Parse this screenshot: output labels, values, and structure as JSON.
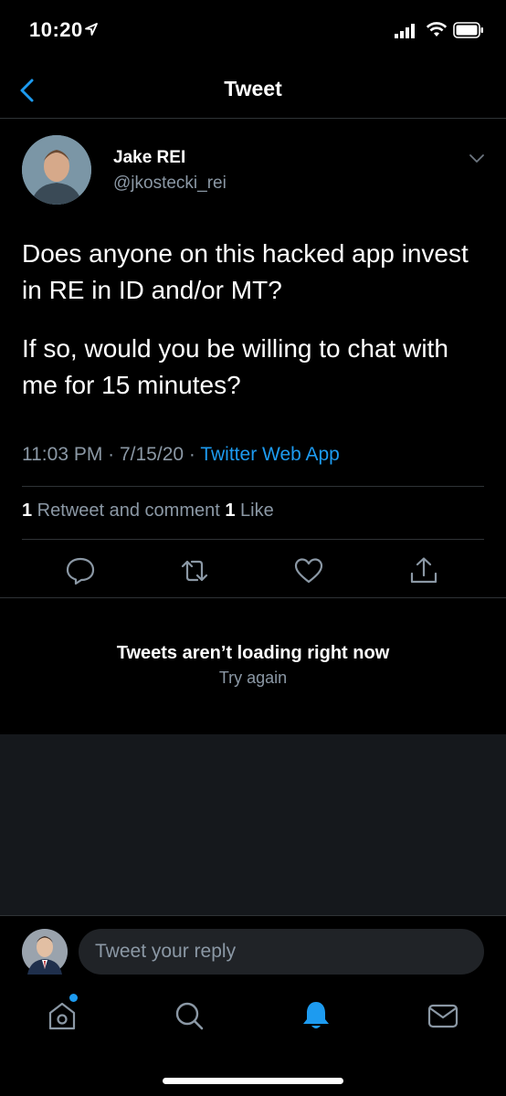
{
  "status_bar": {
    "time": "10:20"
  },
  "nav": {
    "title": "Tweet"
  },
  "tweet": {
    "author_name": "Jake REI",
    "author_handle": "@jkostecki_rei",
    "paragraphs": [
      "Does anyone on this hacked app invest in RE in ID and/or MT?",
      "If so, would you be willing to chat with me for 15 minutes?"
    ],
    "timestamp": "11:03 PM · 7/15/20 · ",
    "source": "Twitter Web App",
    "retweet_count": "1",
    "retweet_label": " Retweet and comment ",
    "like_count": "1",
    "like_label": " Like"
  },
  "replies": {
    "error_title": "Tweets aren’t loading right now",
    "retry_label": "Try again"
  },
  "reply_bar": {
    "placeholder": "Tweet your reply"
  },
  "tabs": [
    "home-icon",
    "search-icon",
    "notifications-icon",
    "messages-icon"
  ],
  "colors": {
    "accent": "#1d9bf0",
    "secondary_text": "#8b98a5",
    "background": "#000000"
  }
}
